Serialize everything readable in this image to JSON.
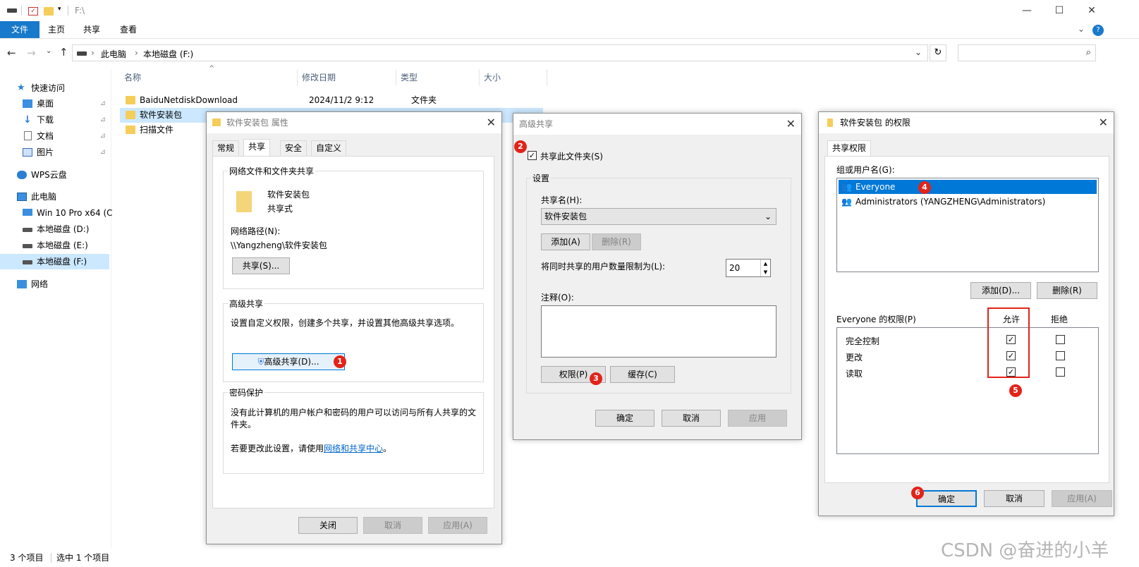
{
  "titlebar": {
    "path": "F:\\",
    "icons": [
      "drive-icon",
      "properties-icon",
      "folder-icon",
      "dropdown-icon"
    ]
  },
  "ribbon": {
    "tabs": [
      "文件",
      "主页",
      "共享",
      "查看"
    ]
  },
  "address": {
    "crumbs": [
      "此电脑",
      "本地磁盘 (F:)"
    ]
  },
  "nav": {
    "items": [
      "快速访问",
      "桌面",
      "下载",
      "文档",
      "图片",
      "WPS云盘",
      "此电脑",
      "Win 10 Pro x64 (C",
      "本地磁盘 (D:)",
      "本地磁盘 (E:)",
      "本地磁盘 (F:)",
      "网络"
    ]
  },
  "columns": {
    "name": "名称",
    "date": "修改日期",
    "type": "类型",
    "size": "大小"
  },
  "files": [
    {
      "name": "BaiduNetdiskDownload",
      "date": "2024/11/2 9:12",
      "type": "文件夹"
    },
    {
      "name": "软件安装包"
    },
    {
      "name": "扫描文件"
    }
  ],
  "status": {
    "count": "3 个项目",
    "selected": "选中 1 个项目"
  },
  "props": {
    "title": "软件安装包 属性",
    "tabs": [
      "常规",
      "共享",
      "安全",
      "自定义"
    ],
    "group1": "网络文件和文件夹共享",
    "folder_name": "软件安装包",
    "share_state": "共享式",
    "path_label": "网络路径(N):",
    "path": "\\\\Yangzheng\\软件安装包",
    "share_btn": "共享(S)...",
    "group2": "高级共享",
    "adv_desc": "设置自定义权限，创建多个共享，并设置其他高级共享选项。",
    "adv_btn": "高级共享(D)...",
    "group3": "密码保护",
    "pwd_desc": "没有此计算机的用户帐户和密码的用户可以访问与所有人共享的文件夹。",
    "pwd_change": "若要更改此设置，请使用",
    "pwd_link": "网络和共享中心",
    "pwd_end": "。",
    "btn_close": "关闭",
    "btn_cancel": "取消",
    "btn_apply": "应用(A)"
  },
  "adv": {
    "title": "高级共享",
    "share_chk": "共享此文件夹(S)",
    "settings": "设置",
    "share_name_label": "共享名(H):",
    "share_name": "软件安装包",
    "add": "添加(A)",
    "remove": "删除(R)",
    "limit_label": "将同时共享的用户数量限制为(L):",
    "limit": "20",
    "comment_label": "注释(O):",
    "perm_btn": "权限(P)",
    "cache_btn": "缓存(C)",
    "ok": "确定",
    "cancel": "取消",
    "apply": "应用"
  },
  "perm": {
    "title": "软件安装包 的权限",
    "tab": "共享权限",
    "group_label": "组或用户名(G):",
    "users": [
      "Everyone",
      "Administrators (YANGZHENG\\Administrators)"
    ],
    "add": "添加(D)...",
    "remove": "删除(R)",
    "perm_label": "Everyone 的权限(P)",
    "allow": "允许",
    "deny": "拒绝",
    "rows": [
      "完全控制",
      "更改",
      "读取"
    ],
    "ok": "确定",
    "cancel": "取消",
    "apply": "应用(A)"
  },
  "badges": [
    "1",
    "2",
    "3",
    "4",
    "5",
    "6"
  ],
  "watermark": "CSDN @奋进的小羊",
  "colors": {
    "accent": "#0078d7",
    "badge": "#e2231a",
    "selection": "#cce8ff",
    "ribbon_file": "#1979ca"
  }
}
